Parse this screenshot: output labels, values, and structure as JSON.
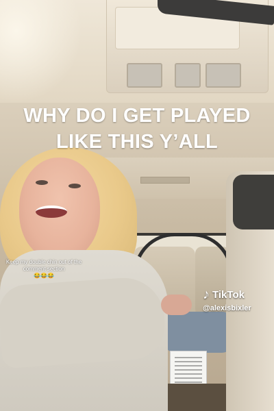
{
  "video": {
    "headline": "WHY DO I GET PLAYED\nLIKE THIS Y’ALL",
    "caption": "Keep my double chin out of the comment section",
    "caption_emoji": "😂😂😂"
  },
  "watermark": {
    "logo_icon": "tiktok-note-icon",
    "logo_glyph": "♪",
    "brand": "TikTok",
    "username": "@alexisbixler"
  },
  "colors": {
    "headline_text": "#ffffff",
    "cabin": "#d8ccb8"
  }
}
